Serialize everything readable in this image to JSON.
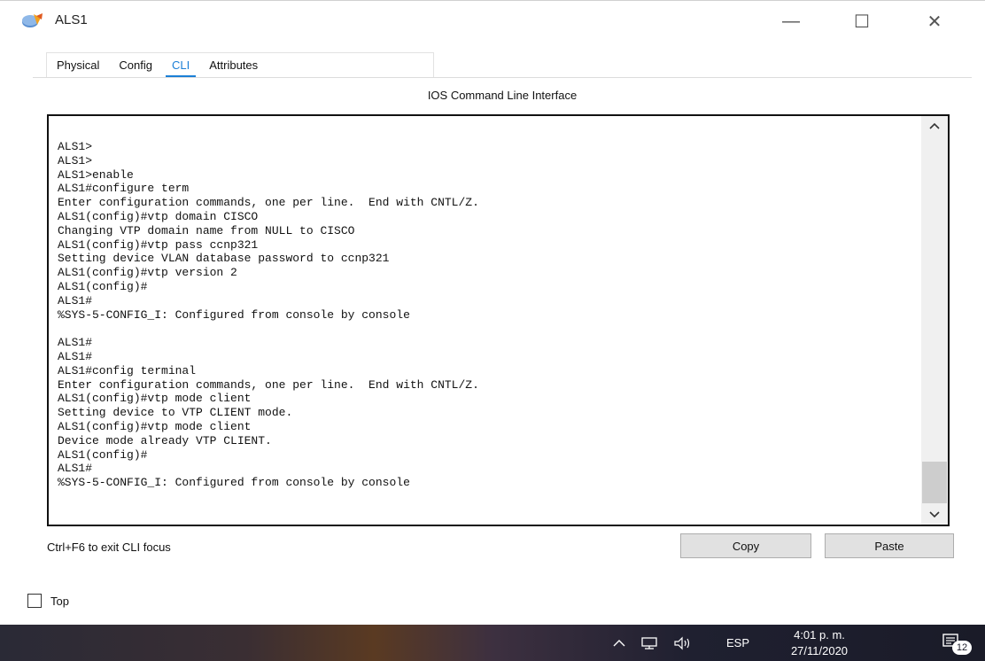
{
  "window": {
    "title": "ALS1",
    "minimize_glyph": "—",
    "maximize_glyph": "☐",
    "close_glyph": "✕"
  },
  "tabs": [
    {
      "label": "Physical",
      "active": false
    },
    {
      "label": "Config",
      "active": false
    },
    {
      "label": "CLI",
      "active": true
    },
    {
      "label": "Attributes",
      "active": false
    }
  ],
  "panel": {
    "header": "IOS Command Line Interface",
    "console_lines": "ALS1>\nALS1>\nALS1>enable\nALS1#configure term\nEnter configuration commands, one per line.  End with CNTL/Z.\nALS1(config)#vtp domain CISCO\nChanging VTP domain name from NULL to CISCO\nALS1(config)#vtp pass ccnp321\nSetting device VLAN database password to ccnp321\nALS1(config)#vtp version 2\nALS1(config)#\nALS1#\n%SYS-5-CONFIG_I: Configured from console by console\n\nALS1#\nALS1#\nALS1#config terminal\nEnter configuration commands, one per line.  End with CNTL/Z.\nALS1(config)#vtp mode client\nSetting device to VTP CLIENT mode.\nALS1(config)#vtp mode client\nDevice mode already VTP CLIENT.\nALS1(config)#\nALS1#\n%SYS-5-CONFIG_I: Configured from console by console",
    "hint": "Ctrl+F6 to exit CLI focus",
    "copy_label": "Copy",
    "paste_label": "Paste"
  },
  "top_checkbox": {
    "label": "Top",
    "checked": false
  },
  "taskbar": {
    "language": "ESP",
    "time": "4:01 p. m.",
    "date": "27/11/2020",
    "notification_count": "12"
  },
  "colors": {
    "accent": "#1b7fd6",
    "button_bg": "#e1e1e1"
  },
  "icons": [
    "packet-tracer-switch-icon",
    "chevron-up-icon",
    "network-icon",
    "speaker-icon",
    "notification-icon"
  ]
}
